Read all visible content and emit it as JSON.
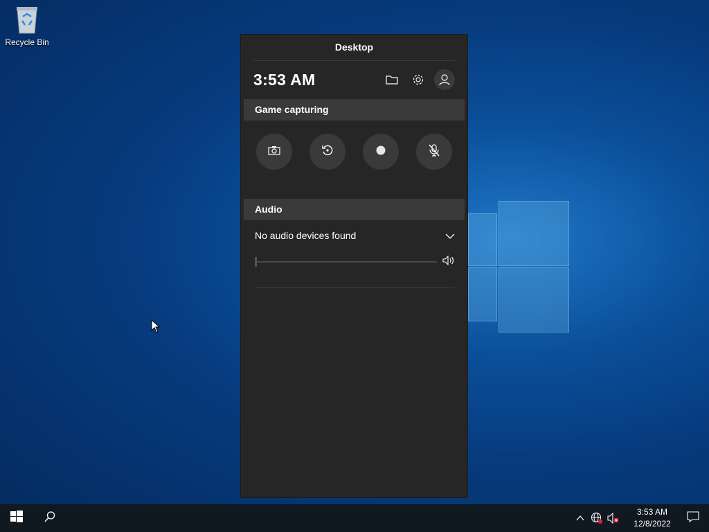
{
  "desktop": {
    "recycle_bin_label": "Recycle Bin"
  },
  "gamebar": {
    "title": "Desktop",
    "time": "3:53 AM",
    "icons": [
      "folder-icon",
      "gear-icon",
      "account-icon"
    ],
    "capture_section": {
      "header": "Game capturing",
      "buttons": [
        "camera-icon",
        "record-last-icon",
        "record-icon",
        "mic-off-icon"
      ]
    },
    "audio_section": {
      "header": "Audio",
      "device_selected": "No audio devices found",
      "volume": 0
    }
  },
  "taskbar": {
    "clock_time": "3:53 AM",
    "clock_date": "12/8/2022"
  },
  "colors": {
    "panel_bg": "#262626",
    "section_bg": "#3a3a3a",
    "taskbar_bg": "#101820"
  }
}
